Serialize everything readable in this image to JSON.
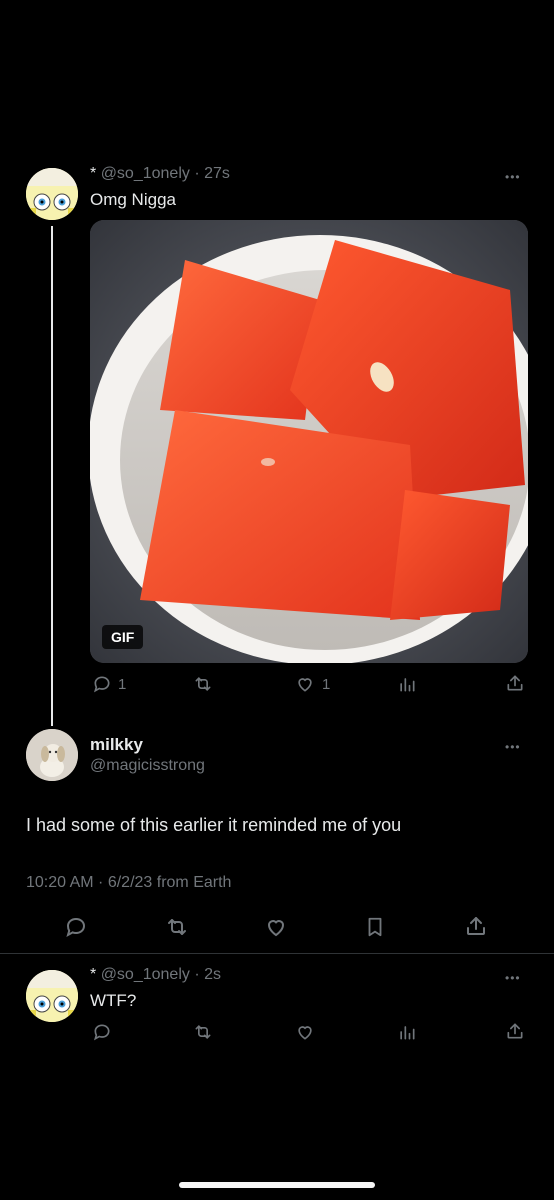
{
  "tweet1": {
    "handle": "@so_1onely",
    "separator": "·",
    "time": "27s",
    "text": "Omg Nigga",
    "gif_badge": "GIF",
    "reply_count": "1",
    "like_count": "1"
  },
  "tweet2": {
    "display_name": "milkky",
    "handle": "@magicisstrong",
    "text": "I had some of this earlier it reminded me of you",
    "meta": "10:20 AM · 6/2/23 from Earth"
  },
  "tweet3": {
    "handle": "@so_1onely",
    "separator": "·",
    "time": "2s",
    "text": "WTF?"
  },
  "ui": {
    "more": "•••",
    "asterisk": "*"
  },
  "colors": {
    "background": "#000000",
    "text": "#e7e9ea",
    "muted": "#71767b",
    "divider": "#2f3336"
  }
}
